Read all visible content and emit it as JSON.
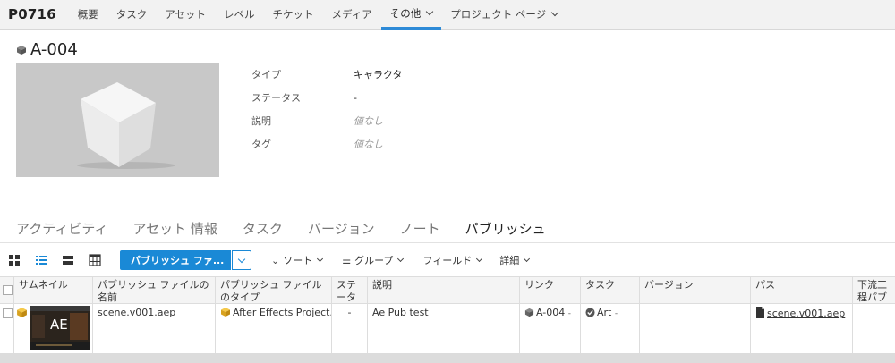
{
  "nav": {
    "project": "P0716",
    "items": [
      {
        "label": "概要"
      },
      {
        "label": "タスク"
      },
      {
        "label": "アセット"
      },
      {
        "label": "レベル"
      },
      {
        "label": "チケット"
      },
      {
        "label": "メディア"
      },
      {
        "label": "その他",
        "active": true
      },
      {
        "label": "プロジェクト ページ"
      }
    ]
  },
  "entity": {
    "title": "A-004",
    "fields": [
      {
        "label": "タイプ",
        "value": "キャラクタ"
      },
      {
        "label": "ステータス",
        "value": "-"
      },
      {
        "label": "説明",
        "value": "値なし"
      },
      {
        "label": "タグ",
        "value": "値なし"
      }
    ]
  },
  "tabs": [
    "アクティビティ",
    "アセット 情報",
    "タスク",
    "バージョン",
    "ノート",
    "パブリッシュ"
  ],
  "toolbar": {
    "publish_button": "パブリッシュ ファ...",
    "sort": "ソート",
    "group": "グループ",
    "fields": "フィールド",
    "detail": "詳細"
  },
  "table": {
    "headers": {
      "thumbnail": "サムネイル",
      "name": "パブリッシュ ファイルの名前",
      "type": "パブリッシュ ファイルのタイプ",
      "status": "ステータス",
      "desc": "説明",
      "link": "リンク",
      "task": "タスク",
      "version": "バージョン",
      "path": "パス",
      "downstream": "下流工程パブリッシュ ファイル"
    },
    "row": {
      "thumb_text": "AE",
      "name": "scene.v001.aep",
      "type": "After Effects Project...",
      "status": "-",
      "desc": "Ae Pub test",
      "link": "A-004",
      "link_more": "-",
      "task": "Art",
      "task_more": "-",
      "path": "scene.v001.aep"
    }
  },
  "colors": {
    "accent": "#1a89d6",
    "nav_bg": "#f2f2f2"
  }
}
